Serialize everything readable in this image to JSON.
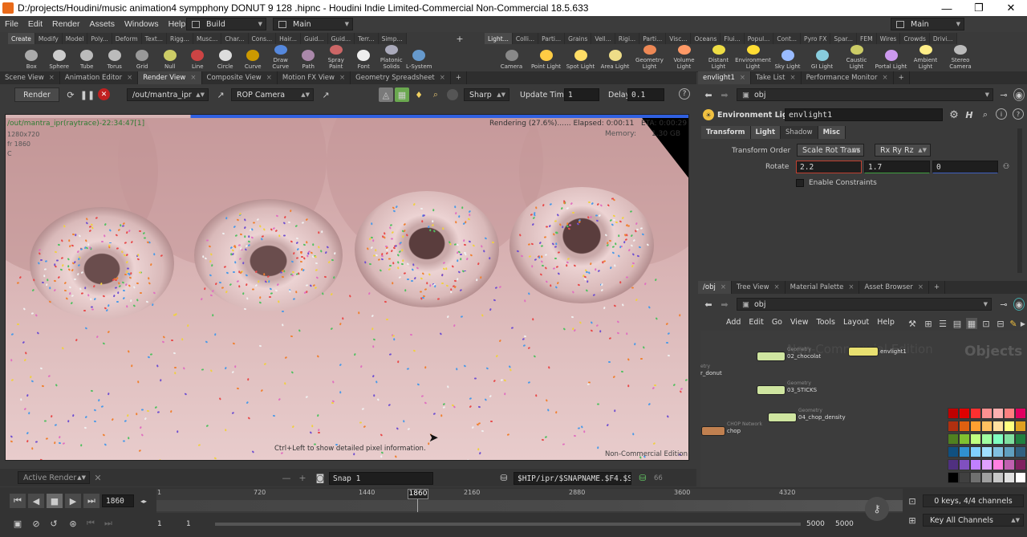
{
  "window": {
    "title": "D:/projects/Houdini/music animation4 sympphony  DONUT 9 128 .hipnc - Houdini Indie Limited-Commercial Non-Commercial 18.5.633",
    "minimize": "—",
    "maximize": "❐",
    "close": "✕"
  },
  "menu": [
    "File",
    "Edit",
    "Render",
    "Assets",
    "Windows",
    "Help"
  ],
  "desktop": {
    "left": "Build",
    "right": "Main"
  },
  "shelf": {
    "tabs_left": [
      "Create",
      "Modify",
      "Model",
      "Poly...",
      "Deform",
      "Text...",
      "Rigg...",
      "Musc...",
      "Char...",
      "Cons...",
      "Hair...",
      "Guid...",
      "Guid...",
      "Terr...",
      "Simp..."
    ],
    "tabs_right": [
      "Light...",
      "Colli...",
      "Parti...",
      "Grains",
      "Vell...",
      "Rigi...",
      "Parti...",
      "Visc...",
      "Oceans",
      "Flui...",
      "Popul...",
      "Cont...",
      "Pyro FX",
      "Spar...",
      "FEM",
      "Wires",
      "Crowds",
      "Drivi..."
    ],
    "tools_left": [
      "Box",
      "Sphere",
      "Tube",
      "Torus",
      "Grid",
      "Null",
      "Line",
      "Circle",
      "Curve",
      "Draw Curve",
      "Path",
      "Spray Paint",
      "Font",
      "Platonic Solids",
      "L-System"
    ],
    "tools_right": [
      "Camera",
      "Point Light",
      "Spot Light",
      "Area Light",
      "Geometry Light",
      "Volume Light",
      "Distant Light",
      "Environment Light",
      "Sky Light",
      "GI Light",
      "Caustic Light",
      "Portal Light",
      "Ambient Light",
      "Stereo Camera"
    ]
  },
  "viewer": {
    "tabs": [
      "Scene View",
      "Animation Editor",
      "Render View",
      "Composite View",
      "Motion FX View",
      "Geometry Spreadsheet"
    ],
    "active_tab": "Render View",
    "render_btn": "Render",
    "rop_path": "/out/mantra_ipr",
    "camera": "ROP Camera",
    "sharp": "Sharp",
    "update_time_label": "Update Time",
    "update_time": "1",
    "delay_label": "Delay",
    "delay": "0.1",
    "overlay_title": "/out/mantra_ipr(raytrace)-22:34:47[1]",
    "overlay_res": "1280x720",
    "overlay_frame": "fr 1860",
    "overlay_c": "C",
    "overlay_status": "Rendering (27.6%)...... Elapsed: 0:00:11   ETA: 0:00:29",
    "overlay_memory_label": "Memory:",
    "overlay_memory": "1.30 GB",
    "hint": "Ctrl+Left to show detailed pixel information.",
    "watermark": "Non-Commercial Edition",
    "bottom_active": "Active Render",
    "snap": "Snap 1",
    "snapname": "$HIP/ipr/$SNAPNAME.$F4.$S",
    "snapcount": "66"
  },
  "params": {
    "tabs": [
      "envlight1",
      "Take List",
      "Performance Monitor"
    ],
    "path": "obj",
    "node_type": "Environment Light",
    "node_name": "envlight1",
    "subtabs": [
      "Transform",
      "Light",
      "Shadow",
      "Misc"
    ],
    "transform_order_label": "Transform Order",
    "transform_order": "Scale Rot Trans",
    "rot_order": "Rx Ry Rz",
    "rotate_label": "Rotate",
    "rotate": [
      "2.2",
      "1.7",
      "0"
    ],
    "constraints": "Enable Constraints"
  },
  "network": {
    "tabs": [
      "/obj",
      "Tree View",
      "Material Palette",
      "Asset Browser"
    ],
    "path": "obj",
    "menu": [
      "Add",
      "Edit",
      "Go",
      "View",
      "Tools",
      "Layout",
      "Help"
    ],
    "watermark": "Non-Commercial Edition",
    "context": "Objects",
    "nodes": [
      {
        "type": "Geometry",
        "name": "02_chocolat"
      },
      {
        "type": "",
        "name": "envlight1"
      },
      {
        "type": "Geometry",
        "name": "03_STICKS"
      },
      {
        "type": "Geometry",
        "name": "04_chop_density"
      },
      {
        "type": "CHOP Network",
        "name": "chop"
      },
      {
        "type": "etry",
        "name": "r_donut"
      }
    ]
  },
  "timeline": {
    "frame": "1860",
    "ticks": [
      "1",
      "720",
      "1440",
      "2160",
      "2880",
      "3600",
      "4320"
    ],
    "cursor": "1860",
    "start": "1",
    "start2": "1",
    "end": "5000",
    "end2": "5000",
    "keys": "0 keys, 4/4 channels",
    "key_all": "Key All Channels"
  },
  "palette": [
    "#c00000",
    "#e00000",
    "#ff3030",
    "#ff9090",
    "#ffb0b0",
    "#ff8080",
    "#e00060",
    "#b03010",
    "#e06010",
    "#ffa030",
    "#ffc060",
    "#ffe0a0",
    "#ffff80",
    "#e0a020",
    "#508020",
    "#80c030",
    "#c0ff80",
    "#a0ffa0",
    "#80ffc0",
    "#80e0a0",
    "#208040",
    "#105080",
    "#3090d0",
    "#80d0ff",
    "#a0e0ff",
    "#80c0e0",
    "#60a0c0",
    "#306080",
    "#503080",
    "#8050c0",
    "#c080ff",
    "#e0a0ff",
    "#ff80e0",
    "#c060b0",
    "#802060",
    "#000000",
    "#404040",
    "#707070",
    "#a0a0a0",
    "#c8c8c8",
    "#e0e0e0",
    "#ffffff"
  ]
}
